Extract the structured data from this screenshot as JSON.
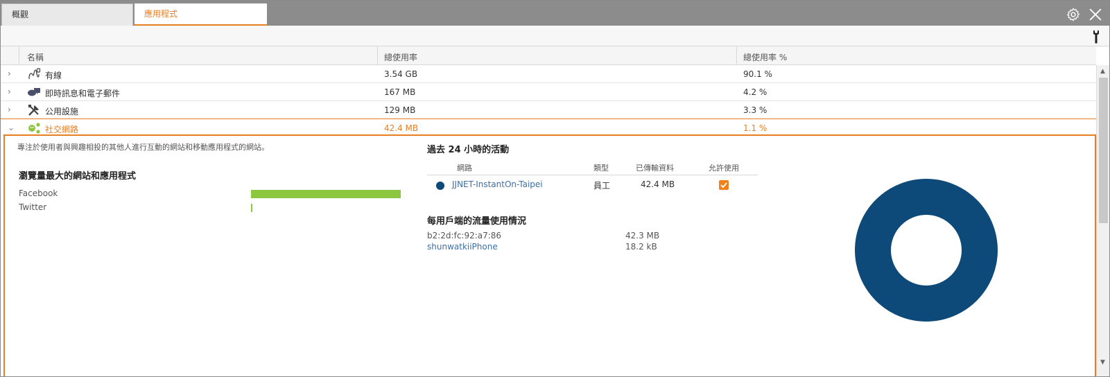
{
  "tabs": [
    {
      "label": "概觀"
    },
    {
      "label": "應用程式"
    }
  ],
  "columns": {
    "name": "名稱",
    "usage": "總使用率",
    "pct": "總使用率 %"
  },
  "rows": [
    {
      "name": "有線",
      "usage": "3.54 GB",
      "pct": "90.1 %",
      "icon": "wired-icon"
    },
    {
      "name": "即時訊息和電子郵件",
      "usage": "167 MB",
      "pct": "4.2 %",
      "icon": "chat-icon"
    },
    {
      "name": "公用設施",
      "usage": "129 MB",
      "pct": "3.3 %",
      "icon": "tools-icon"
    },
    {
      "name": "社交網路",
      "usage": "42.4 MB",
      "pct": "1.1 %",
      "icon": "social-icon"
    }
  ],
  "detail": {
    "description": "專注於使用者與興趣相投的其他人進行互動的網站和移動應用程式的網站。",
    "top_sites_title": "瀏覽量最大的網站和應用程式",
    "top_sites": [
      {
        "name": "Facebook",
        "share": 1.0
      },
      {
        "name": "Twitter",
        "share": 0.01
      }
    ],
    "activity_title": "過去 24 小時的活動",
    "activity_headers": {
      "network": "網路",
      "type": "類型",
      "transferred": "已傳輸資料",
      "allowed": "允許使用"
    },
    "activity_rows": [
      {
        "network": "JJNET-InstantOn-Taipei",
        "type": "員工",
        "transferred": "42.4 MB",
        "allowed": true
      }
    ],
    "clients_title": "每用戶端的流量使用情況",
    "clients": [
      {
        "name": "b2:2d:fc:92:a7:86",
        "usage": "42.3 MB",
        "link": false
      },
      {
        "name": "shunwatkiiPhone",
        "usage": "18.2 kB",
        "link": true
      }
    ]
  },
  "colors": {
    "accent": "#e67e22",
    "bar": "#8dc63f",
    "network": "#0d4a7a"
  }
}
